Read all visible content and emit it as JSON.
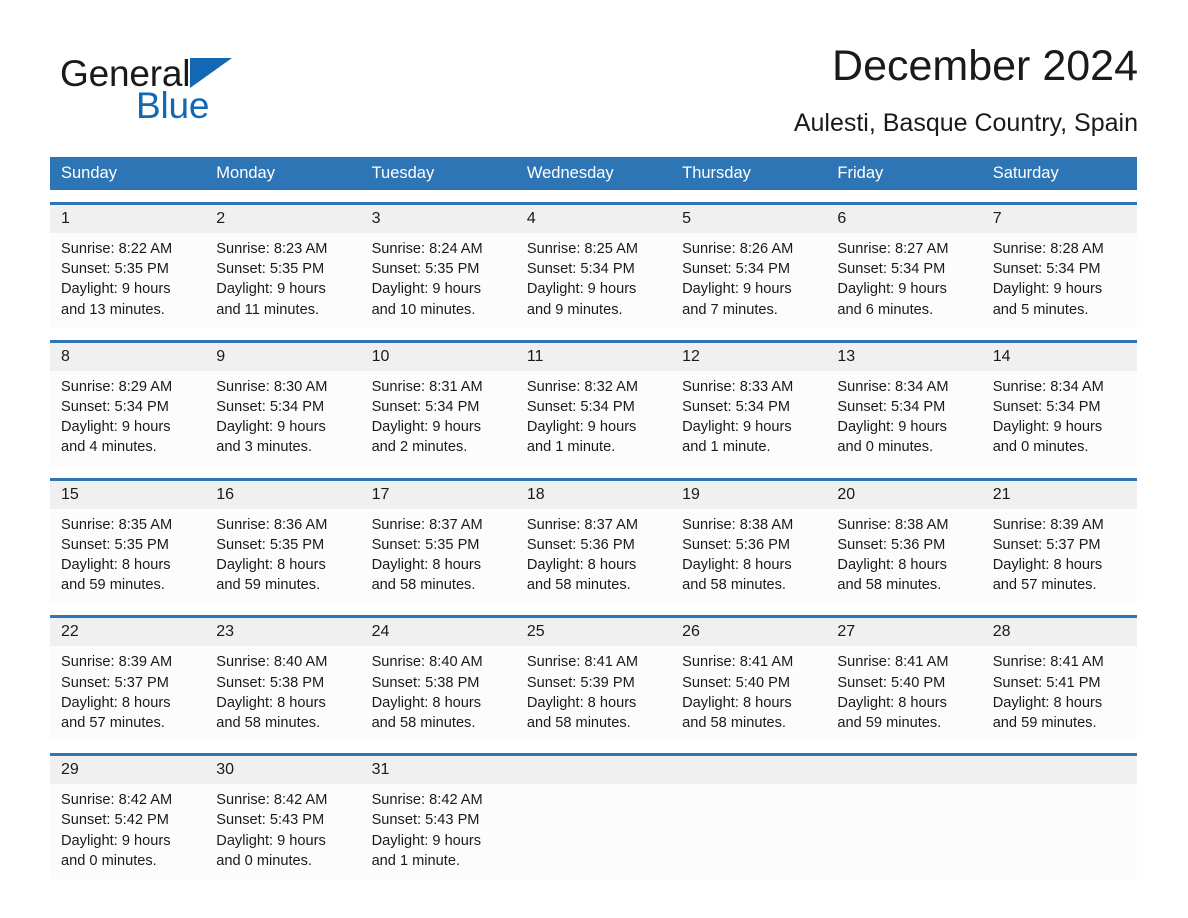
{
  "brand": {
    "word_general": "General",
    "word_blue": "Blue",
    "accent_color": "#1268b3",
    "triangle_icon": "triangle-icon"
  },
  "header": {
    "month_title": "December 2024",
    "location": "Aulesti, Basque Country, Spain"
  },
  "calendar": {
    "header_bg": "#2e75b6",
    "date_band_bg": "#f0f0f0",
    "weekdays": [
      "Sunday",
      "Monday",
      "Tuesday",
      "Wednesday",
      "Thursday",
      "Friday",
      "Saturday"
    ],
    "weeks": [
      {
        "days": [
          {
            "date": "1",
            "sunrise": "Sunrise: 8:22 AM",
            "sunset": "Sunset: 5:35 PM",
            "daylight_1": "Daylight: 9 hours",
            "daylight_2": "and 13 minutes."
          },
          {
            "date": "2",
            "sunrise": "Sunrise: 8:23 AM",
            "sunset": "Sunset: 5:35 PM",
            "daylight_1": "Daylight: 9 hours",
            "daylight_2": "and 11 minutes."
          },
          {
            "date": "3",
            "sunrise": "Sunrise: 8:24 AM",
            "sunset": "Sunset: 5:35 PM",
            "daylight_1": "Daylight: 9 hours",
            "daylight_2": "and 10 minutes."
          },
          {
            "date": "4",
            "sunrise": "Sunrise: 8:25 AM",
            "sunset": "Sunset: 5:34 PM",
            "daylight_1": "Daylight: 9 hours",
            "daylight_2": "and 9 minutes."
          },
          {
            "date": "5",
            "sunrise": "Sunrise: 8:26 AM",
            "sunset": "Sunset: 5:34 PM",
            "daylight_1": "Daylight: 9 hours",
            "daylight_2": "and 7 minutes."
          },
          {
            "date": "6",
            "sunrise": "Sunrise: 8:27 AM",
            "sunset": "Sunset: 5:34 PM",
            "daylight_1": "Daylight: 9 hours",
            "daylight_2": "and 6 minutes."
          },
          {
            "date": "7",
            "sunrise": "Sunrise: 8:28 AM",
            "sunset": "Sunset: 5:34 PM",
            "daylight_1": "Daylight: 9 hours",
            "daylight_2": "and 5 minutes."
          }
        ]
      },
      {
        "days": [
          {
            "date": "8",
            "sunrise": "Sunrise: 8:29 AM",
            "sunset": "Sunset: 5:34 PM",
            "daylight_1": "Daylight: 9 hours",
            "daylight_2": "and 4 minutes."
          },
          {
            "date": "9",
            "sunrise": "Sunrise: 8:30 AM",
            "sunset": "Sunset: 5:34 PM",
            "daylight_1": "Daylight: 9 hours",
            "daylight_2": "and 3 minutes."
          },
          {
            "date": "10",
            "sunrise": "Sunrise: 8:31 AM",
            "sunset": "Sunset: 5:34 PM",
            "daylight_1": "Daylight: 9 hours",
            "daylight_2": "and 2 minutes."
          },
          {
            "date": "11",
            "sunrise": "Sunrise: 8:32 AM",
            "sunset": "Sunset: 5:34 PM",
            "daylight_1": "Daylight: 9 hours",
            "daylight_2": "and 1 minute."
          },
          {
            "date": "12",
            "sunrise": "Sunrise: 8:33 AM",
            "sunset": "Sunset: 5:34 PM",
            "daylight_1": "Daylight: 9 hours",
            "daylight_2": "and 1 minute."
          },
          {
            "date": "13",
            "sunrise": "Sunrise: 8:34 AM",
            "sunset": "Sunset: 5:34 PM",
            "daylight_1": "Daylight: 9 hours",
            "daylight_2": "and 0 minutes."
          },
          {
            "date": "14",
            "sunrise": "Sunrise: 8:34 AM",
            "sunset": "Sunset: 5:34 PM",
            "daylight_1": "Daylight: 9 hours",
            "daylight_2": "and 0 minutes."
          }
        ]
      },
      {
        "days": [
          {
            "date": "15",
            "sunrise": "Sunrise: 8:35 AM",
            "sunset": "Sunset: 5:35 PM",
            "daylight_1": "Daylight: 8 hours",
            "daylight_2": "and 59 minutes."
          },
          {
            "date": "16",
            "sunrise": "Sunrise: 8:36 AM",
            "sunset": "Sunset: 5:35 PM",
            "daylight_1": "Daylight: 8 hours",
            "daylight_2": "and 59 minutes."
          },
          {
            "date": "17",
            "sunrise": "Sunrise: 8:37 AM",
            "sunset": "Sunset: 5:35 PM",
            "daylight_1": "Daylight: 8 hours",
            "daylight_2": "and 58 minutes."
          },
          {
            "date": "18",
            "sunrise": "Sunrise: 8:37 AM",
            "sunset": "Sunset: 5:36 PM",
            "daylight_1": "Daylight: 8 hours",
            "daylight_2": "and 58 minutes."
          },
          {
            "date": "19",
            "sunrise": "Sunrise: 8:38 AM",
            "sunset": "Sunset: 5:36 PM",
            "daylight_1": "Daylight: 8 hours",
            "daylight_2": "and 58 minutes."
          },
          {
            "date": "20",
            "sunrise": "Sunrise: 8:38 AM",
            "sunset": "Sunset: 5:36 PM",
            "daylight_1": "Daylight: 8 hours",
            "daylight_2": "and 58 minutes."
          },
          {
            "date": "21",
            "sunrise": "Sunrise: 8:39 AM",
            "sunset": "Sunset: 5:37 PM",
            "daylight_1": "Daylight: 8 hours",
            "daylight_2": "and 57 minutes."
          }
        ]
      },
      {
        "days": [
          {
            "date": "22",
            "sunrise": "Sunrise: 8:39 AM",
            "sunset": "Sunset: 5:37 PM",
            "daylight_1": "Daylight: 8 hours",
            "daylight_2": "and 57 minutes."
          },
          {
            "date": "23",
            "sunrise": "Sunrise: 8:40 AM",
            "sunset": "Sunset: 5:38 PM",
            "daylight_1": "Daylight: 8 hours",
            "daylight_2": "and 58 minutes."
          },
          {
            "date": "24",
            "sunrise": "Sunrise: 8:40 AM",
            "sunset": "Sunset: 5:38 PM",
            "daylight_1": "Daylight: 8 hours",
            "daylight_2": "and 58 minutes."
          },
          {
            "date": "25",
            "sunrise": "Sunrise: 8:41 AM",
            "sunset": "Sunset: 5:39 PM",
            "daylight_1": "Daylight: 8 hours",
            "daylight_2": "and 58 minutes."
          },
          {
            "date": "26",
            "sunrise": "Sunrise: 8:41 AM",
            "sunset": "Sunset: 5:40 PM",
            "daylight_1": "Daylight: 8 hours",
            "daylight_2": "and 58 minutes."
          },
          {
            "date": "27",
            "sunrise": "Sunrise: 8:41 AM",
            "sunset": "Sunset: 5:40 PM",
            "daylight_1": "Daylight: 8 hours",
            "daylight_2": "and 59 minutes."
          },
          {
            "date": "28",
            "sunrise": "Sunrise: 8:41 AM",
            "sunset": "Sunset: 5:41 PM",
            "daylight_1": "Daylight: 8 hours",
            "daylight_2": "and 59 minutes."
          }
        ]
      },
      {
        "days": [
          {
            "date": "29",
            "sunrise": "Sunrise: 8:42 AM",
            "sunset": "Sunset: 5:42 PM",
            "daylight_1": "Daylight: 9 hours",
            "daylight_2": "and 0 minutes."
          },
          {
            "date": "30",
            "sunrise": "Sunrise: 8:42 AM",
            "sunset": "Sunset: 5:43 PM",
            "daylight_1": "Daylight: 9 hours",
            "daylight_2": "and 0 minutes."
          },
          {
            "date": "31",
            "sunrise": "Sunrise: 8:42 AM",
            "sunset": "Sunset: 5:43 PM",
            "daylight_1": "Daylight: 9 hours",
            "daylight_2": "and 1 minute."
          },
          {
            "date": "",
            "sunrise": "",
            "sunset": "",
            "daylight_1": "",
            "daylight_2": ""
          },
          {
            "date": "",
            "sunrise": "",
            "sunset": "",
            "daylight_1": "",
            "daylight_2": ""
          },
          {
            "date": "",
            "sunrise": "",
            "sunset": "",
            "daylight_1": "",
            "daylight_2": ""
          },
          {
            "date": "",
            "sunrise": "",
            "sunset": "",
            "daylight_1": "",
            "daylight_2": ""
          }
        ]
      }
    ]
  }
}
